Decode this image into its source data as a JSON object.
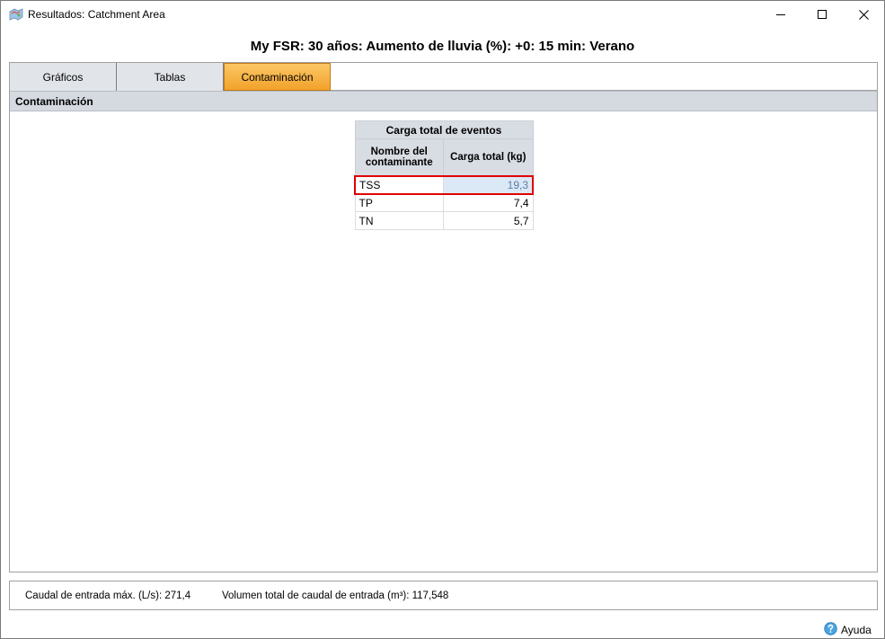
{
  "window": {
    "title": "Resultados: Catchment Area",
    "icon": "app-map-icon",
    "controls": [
      "minimize-icon",
      "maximize-icon",
      "close-icon"
    ]
  },
  "scenario_title": "My FSR: 30 años: Aumento de lluvia (%): +0: 15 min: Verano",
  "tabs": [
    {
      "label": "Gráficos",
      "active": false
    },
    {
      "label": "Tablas",
      "active": false
    },
    {
      "label": "Contaminación",
      "active": true
    }
  ],
  "section": {
    "title": "Contaminación"
  },
  "pollutant_table": {
    "caption": "Carga total de eventos",
    "columns": [
      "Nombre del contaminante",
      "Carga total (kg)"
    ],
    "rows": [
      {
        "name": "TSS",
        "value": "19,3",
        "selected": true
      },
      {
        "name": "TP",
        "value": "7,4",
        "selected": false
      },
      {
        "name": "TN",
        "value": "5,7",
        "selected": false
      }
    ]
  },
  "status": {
    "caudal_label": "Caudal de entrada máx. (L/s):",
    "caudal_value": "271,4",
    "volumen_label": "Volumen total de caudal de entrada (m³):",
    "volumen_value": "117,548"
  },
  "help": {
    "label": "Ayuda",
    "icon": "help-icon"
  },
  "colors": {
    "active_tab": "#f2a22a",
    "header_bg": "#d5d9e0",
    "selection_border": "#e00000",
    "selected_cell_bg": "#dbe8f5"
  }
}
